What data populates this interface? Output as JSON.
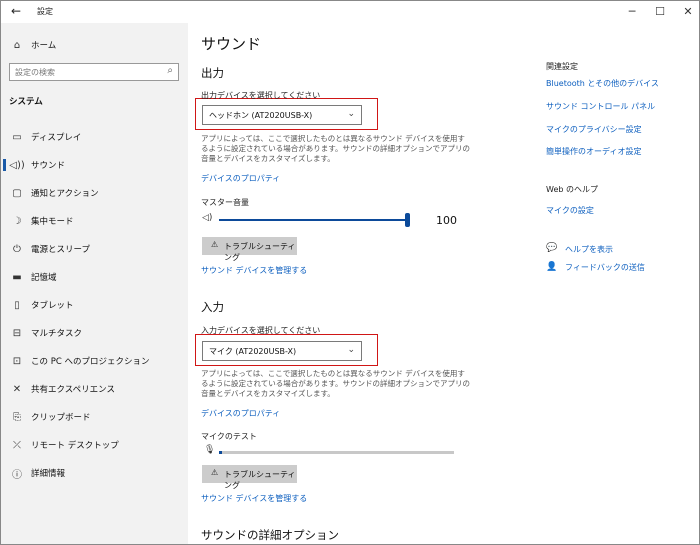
{
  "window": {
    "back_icon": "back-arrow-icon",
    "title": "設定",
    "controls": {
      "minimize": "─",
      "maximize": "☐",
      "close": "✕"
    }
  },
  "sidebar": {
    "home": {
      "label": "ホーム",
      "icon": "home-icon"
    },
    "search": {
      "placeholder": "設定の検索"
    },
    "section": "システム",
    "items": [
      {
        "label": "ディスプレイ",
        "icon": "display-icon"
      },
      {
        "label": "サウンド",
        "icon": "sound-icon",
        "selected": true
      },
      {
        "label": "通知とアクション",
        "icon": "notification-icon"
      },
      {
        "label": "集中モード",
        "icon": "moon-icon"
      },
      {
        "label": "電源とスリープ",
        "icon": "power-icon"
      },
      {
        "label": "記憶域",
        "icon": "storage-icon"
      },
      {
        "label": "タブレット",
        "icon": "tablet-icon"
      },
      {
        "label": "マルチタスク",
        "icon": "multitask-icon"
      },
      {
        "label": "この PC へのプロジェクション",
        "icon": "projection-icon"
      },
      {
        "label": "共有エクスペリエンス",
        "icon": "shared-icon"
      },
      {
        "label": "クリップボード",
        "icon": "clipboard-icon"
      },
      {
        "label": "リモート デスクトップ",
        "icon": "remote-icon"
      },
      {
        "label": "詳細情報",
        "icon": "info-icon"
      }
    ]
  },
  "main": {
    "title": "サウンド",
    "output": {
      "heading": "出力",
      "device_label": "出力デバイスを選択してください",
      "device_value": "ヘッドホン (AT2020USB-X)",
      "description": "アプリによっては、ここで選択したものとは異なるサウンド デバイスを使用するように設定されている場合があります。サウンドの詳細オプションでアプリの音量とデバイスをカスタマイズします。",
      "properties_link": "デバイスのプロパティ",
      "volume_label": "マスター音量",
      "volume_value": "100",
      "volume_fraction": 1.0,
      "troubleshoot": "トラブルシューティング",
      "manage_link": "サウンド デバイスを管理する"
    },
    "input": {
      "heading": "入力",
      "device_label": "入力デバイスを選択してください",
      "device_value": "マイク (AT2020USB-X)",
      "description": "アプリによっては、ここで選択したものとは異なるサウンド デバイスを使用するように設定されている場合があります。サウンドの詳細オプションでアプリの音量とデバイスをカスタマイズします。",
      "properties_link": "デバイスのプロパティ",
      "test_label": "マイクのテスト",
      "mic_level_fraction": 0.0,
      "troubleshoot": "トラブルシューティング",
      "manage_link": "サウンド デバイスを管理する"
    },
    "advanced_heading": "サウンドの詳細オプション"
  },
  "rail": {
    "related_heading": "関連設定",
    "related_links": [
      "Bluetooth とその他のデバイス",
      "サウンド コントロール パネル",
      "マイクのプライバシー設定",
      "簡単操作のオーディオ設定"
    ],
    "web_help_heading": "Web のヘルプ",
    "web_help_link": "マイクの設定",
    "help_link": "ヘルプを表示",
    "feedback_link": "フィードバックの送信"
  },
  "colors": {
    "accent": "#0d5fbf",
    "highlight": "#d01616",
    "sidebar_bg": "#f2f2f2"
  }
}
